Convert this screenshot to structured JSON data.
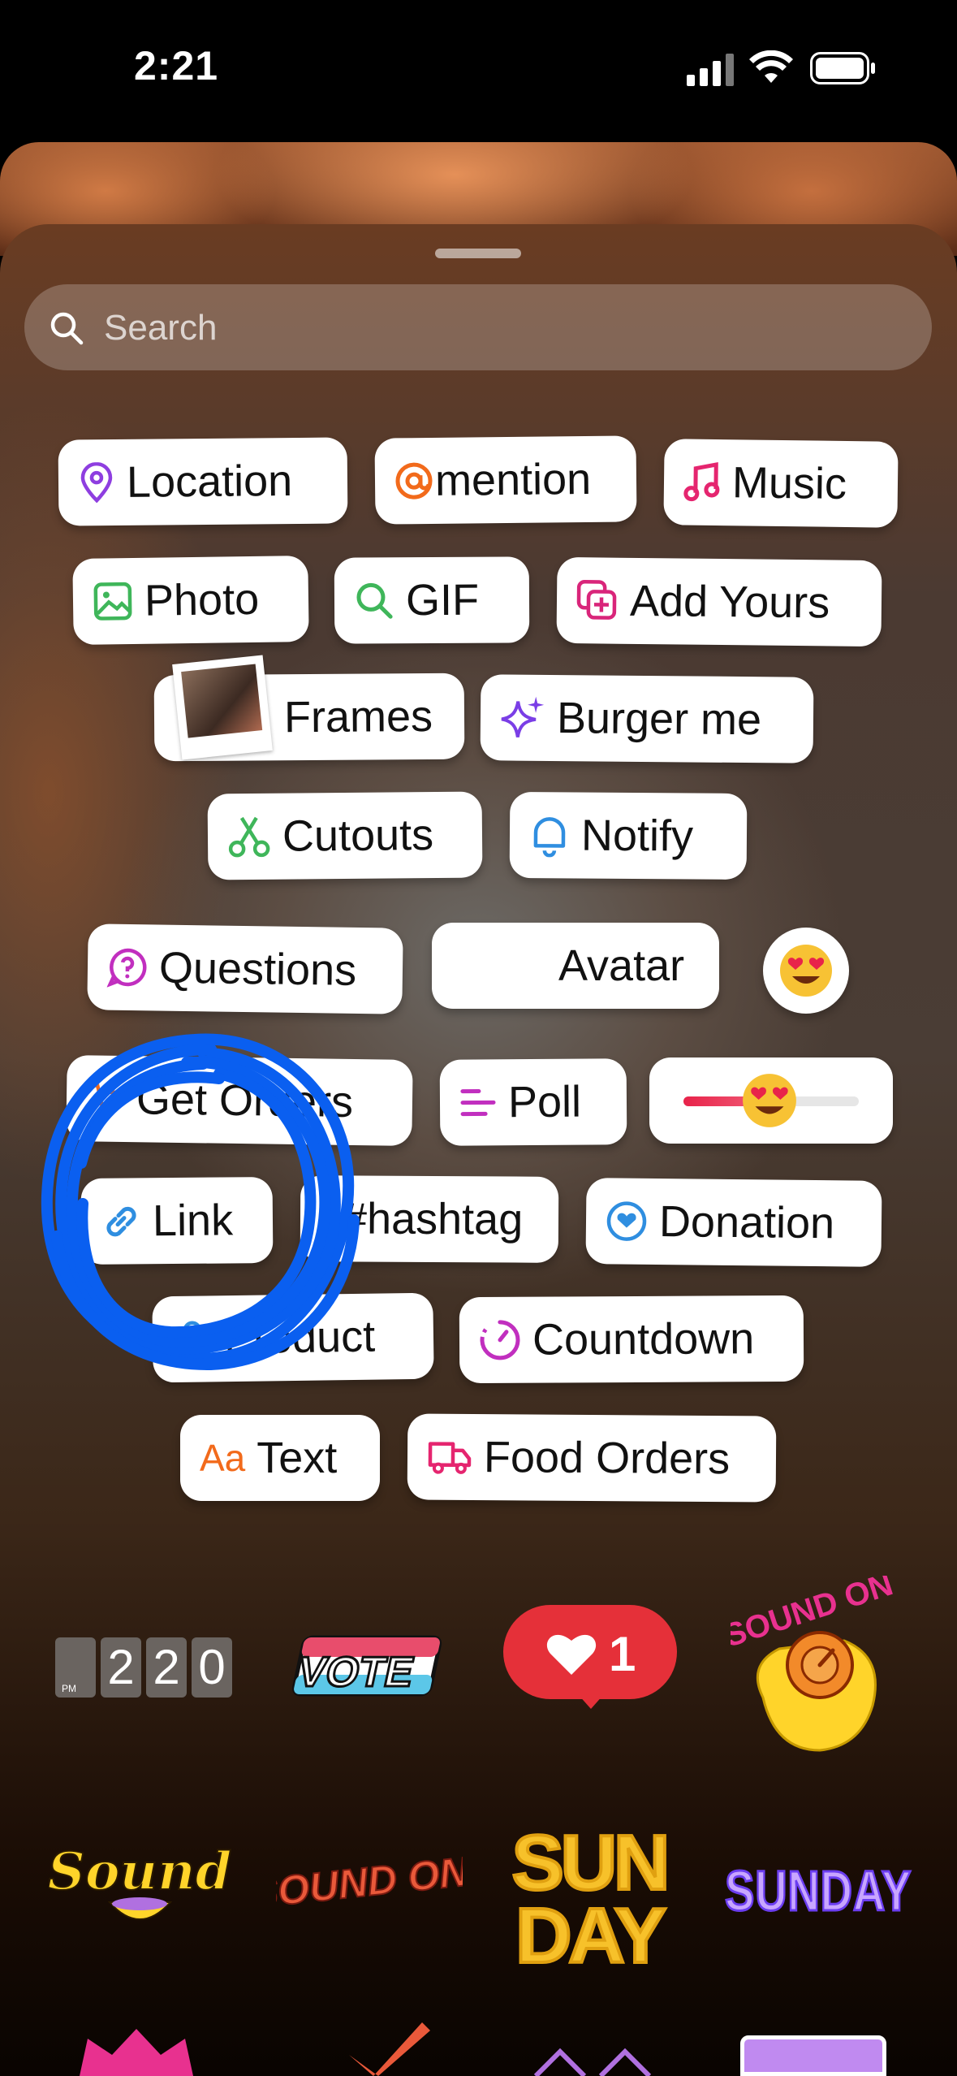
{
  "status_bar": {
    "time": "2:21"
  },
  "search": {
    "placeholder": "Search"
  },
  "stickers": [
    {
      "label": "Location",
      "icon": "location-pin-icon",
      "color": "#8e3ee0"
    },
    {
      "label": "mention",
      "icon": "at-sign-icon",
      "color": "#f26a1b"
    },
    {
      "label": "Music",
      "icon": "music-note-icon",
      "color": "#e5256f"
    },
    {
      "label": "Photo",
      "icon": "image-icon",
      "color": "#3fb65a"
    },
    {
      "label": "GIF",
      "icon": "search-icon",
      "color": "#3fb65a"
    },
    {
      "label": "Add Yours",
      "icon": "add-yours-icon",
      "color": "#d9257a"
    },
    {
      "label": "Frames",
      "icon": "polaroid-icon",
      "color": "#000000"
    },
    {
      "label": "Burger me",
      "icon": "sparkles-icon",
      "color": "#7a3ee6"
    },
    {
      "label": "Cutouts",
      "icon": "scissors-icon",
      "color": "#3fb65a"
    },
    {
      "label": "Notify",
      "icon": "bell-icon",
      "color": "#2f8ee0"
    },
    {
      "label": "Questions",
      "icon": "question-bubble-icon",
      "color": "#c12fbf"
    },
    {
      "label": "Avatar",
      "icon": "avatar-icon",
      "color": "#888888"
    },
    {
      "label": "Get Orders",
      "icon": "order-icon",
      "color": "#f26a1b"
    },
    {
      "label": "Poll",
      "icon": "poll-icon",
      "color": "#c12fbf"
    },
    {
      "label": "Link",
      "icon": "link-icon",
      "color": "#2f8ee0"
    },
    {
      "label": "#hashtag",
      "icon": "hashtag-icon",
      "color": "#7a3ee6"
    },
    {
      "label": "Donation",
      "icon": "heart-circle-icon",
      "color": "#2f8ee0"
    },
    {
      "label": "Product",
      "icon": "bag-icon",
      "color": "#2f8ee0"
    },
    {
      "label": "Countdown",
      "icon": "timer-icon",
      "color": "#c12fbf"
    },
    {
      "label": "Aa",
      "icon": "text-icon",
      "color": "#f26a1b"
    },
    {
      "label": "Text",
      "icon": "text-icon",
      "color": "#111111"
    },
    {
      "label": "Food Orders",
      "icon": "delivery-truck-icon",
      "color": "#e5256f"
    }
  ],
  "emoji_slider": {
    "emoji": "😍"
  },
  "emoji_sticker": {
    "emoji": "😍"
  },
  "gallery": {
    "clock_digits": [
      "2",
      "2",
      "0"
    ],
    "clock_ampm": "PM",
    "vote_text": "VOTE",
    "like_count": "1",
    "sound_on_text": "SOUND ON",
    "sound_text": "Sound",
    "sound_on_red_text": "SOUND ON!",
    "sunday_bubble_text": "SUN DAY",
    "sunday_text": "SUNDAY"
  },
  "annotation": {
    "color": "#0a5ff0"
  }
}
